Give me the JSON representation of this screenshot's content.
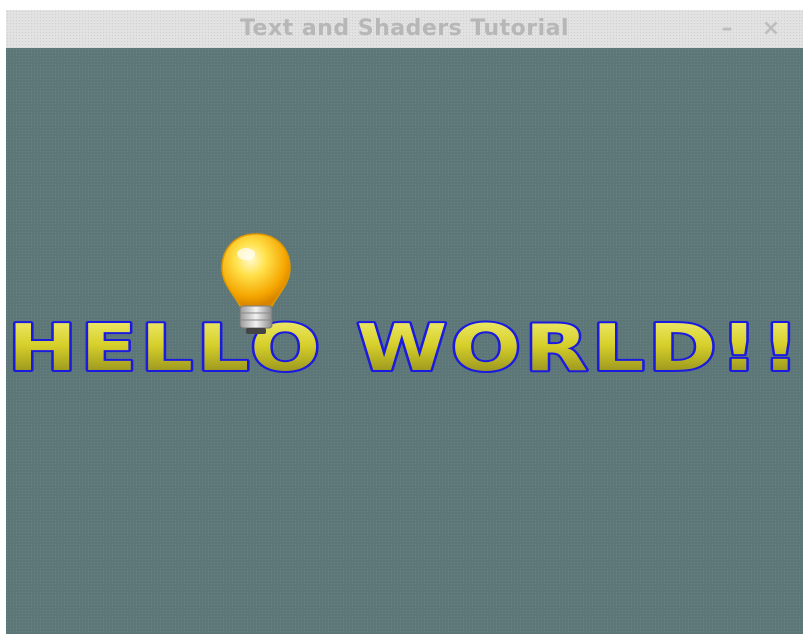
{
  "window": {
    "title": "Text and Shaders Tutorial",
    "minimize_glyph": "–",
    "close_glyph": "×"
  },
  "scene": {
    "text": "HELLO WORLD!!",
    "icon": "lightbulb-icon",
    "colors": {
      "background": "#5d7678",
      "text_fill": "#d8d030",
      "text_outline": "#1a1ae0",
      "bulb_glow": "#ffd020"
    }
  }
}
